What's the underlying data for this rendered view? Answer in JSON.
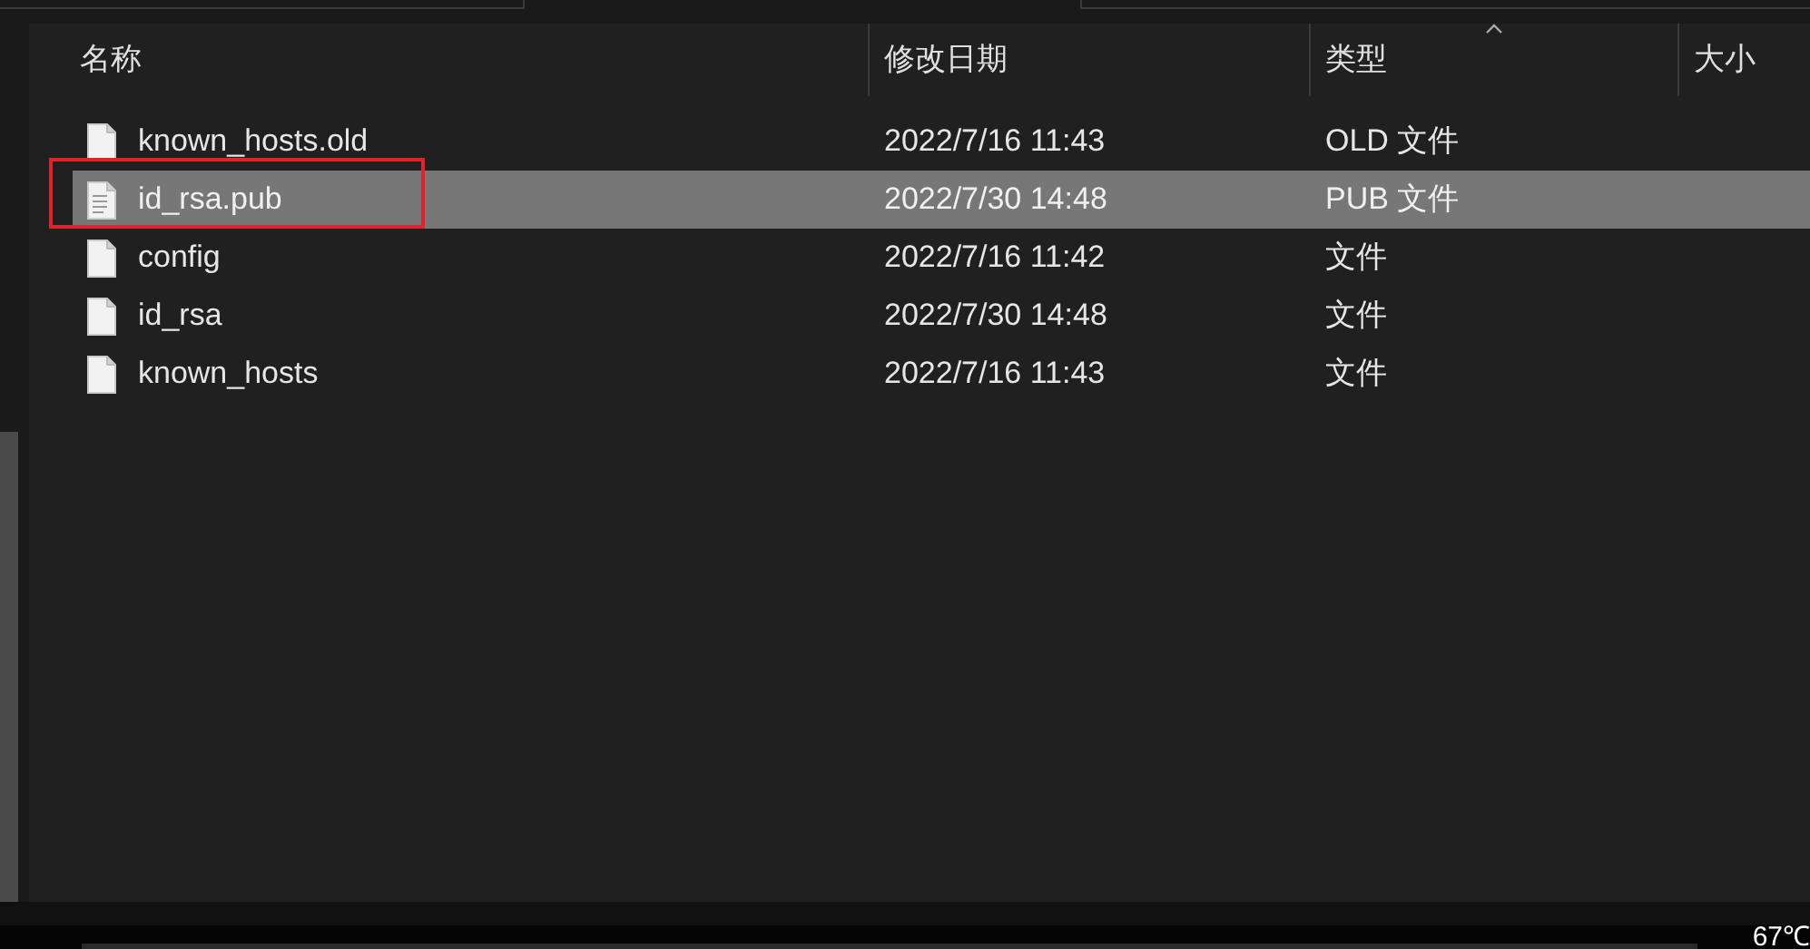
{
  "table": {
    "columns": [
      {
        "label": "名称"
      },
      {
        "label": "修改日期"
      },
      {
        "label": "类型",
        "sorted": true
      },
      {
        "label": "大小"
      }
    ],
    "rows": [
      {
        "name": "known_hosts.old",
        "date": "2022/7/16 11:43",
        "type": "OLD 文件",
        "selected": false,
        "kind": "blank"
      },
      {
        "name": "id_rsa.pub",
        "date": "2022/7/30 14:48",
        "type": "PUB 文件",
        "selected": true,
        "kind": "text",
        "annotated": true
      },
      {
        "name": "config",
        "date": "2022/7/16 11:42",
        "type": "文件",
        "selected": false,
        "kind": "blank"
      },
      {
        "name": "id_rsa",
        "date": "2022/7/30 14:48",
        "type": "文件",
        "selected": false,
        "kind": "blank"
      },
      {
        "name": "known_hosts",
        "date": "2022/7/16 11:43",
        "type": "文件",
        "selected": false,
        "kind": "blank"
      }
    ]
  },
  "taskbar": {
    "temperature": "67℃"
  }
}
